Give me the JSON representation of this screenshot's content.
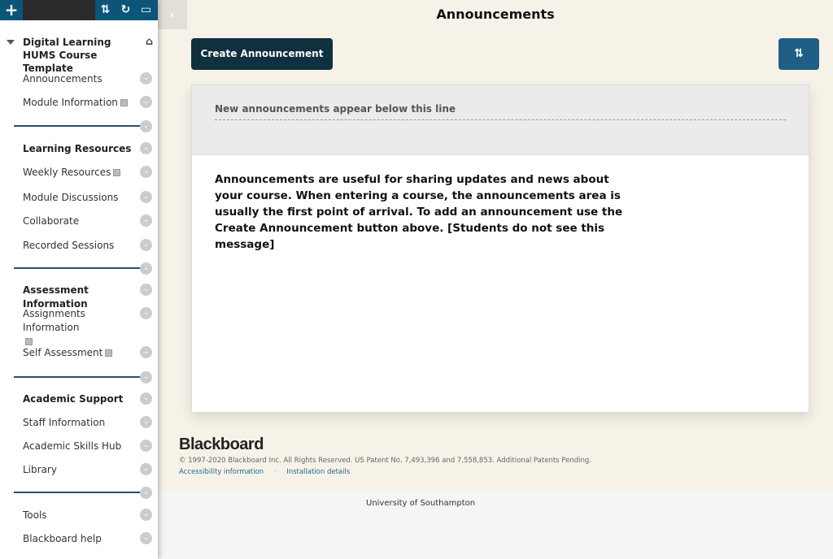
{
  "sidebar": {
    "course_title": "Digital Learning HUMS Course Template",
    "items": [
      "Announcements",
      "Module Information",
      "Learning Resources",
      "Weekly Resources",
      "Module Discussions",
      "Collaborate",
      "Recorded Sessions",
      "Assessment Information",
      "Assignments Information",
      "Self Assessment",
      "Academic Support",
      "Staff Information",
      "Academic Skills Hub",
      "Library",
      "Tools",
      "Blackboard help"
    ]
  },
  "header": {
    "title": "Announcements"
  },
  "main": {
    "create_label": "Create Announcement",
    "divider_text": "New announcements appear below this line",
    "message": "Announcements are useful for sharing updates and news about your course. When entering a course, the announcements area is usually the first point of arrival. To add an announcement use the Create Announcement button above. [Students do not see this message]"
  },
  "footer": {
    "logo": "Blackboard",
    "copyright": "© 1997-2020 Blackboard Inc. All Rights Reserved. US Patent No. 7,493,396 and 7,558,853. Additional Patents Pending.",
    "accessibility": "Accessibility information",
    "separator": "·",
    "installation": "Installation details",
    "university": "University of Southampton"
  },
  "colors": {
    "accent": "#0b5579",
    "button_dark": "#10303f",
    "divider": "#2a4f66"
  }
}
